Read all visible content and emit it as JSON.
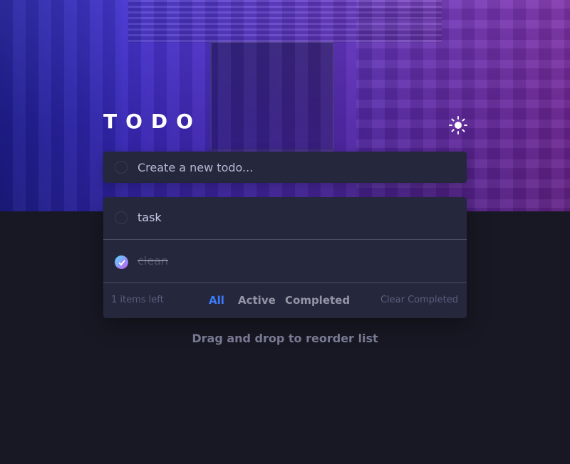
{
  "app": {
    "title": "TODO",
    "theme_toggle_icon": "sun-icon"
  },
  "new_todo": {
    "placeholder": "Create a new todo...",
    "value": ""
  },
  "todos": [
    {
      "text": "task",
      "completed": false
    },
    {
      "text": "clean",
      "completed": true
    }
  ],
  "footer": {
    "items_left": "1 items left",
    "filters": [
      "All",
      "Active",
      "Completed"
    ],
    "active_filter": "All",
    "clear_label": "Clear Completed"
  },
  "hint": "Drag and drop to reorder list",
  "colors": {
    "accent": "#3a7cfd",
    "check_gradient_start": "#57ddff",
    "check_gradient_end": "#c058f3",
    "background": "#181824",
    "card": "#25273c"
  }
}
